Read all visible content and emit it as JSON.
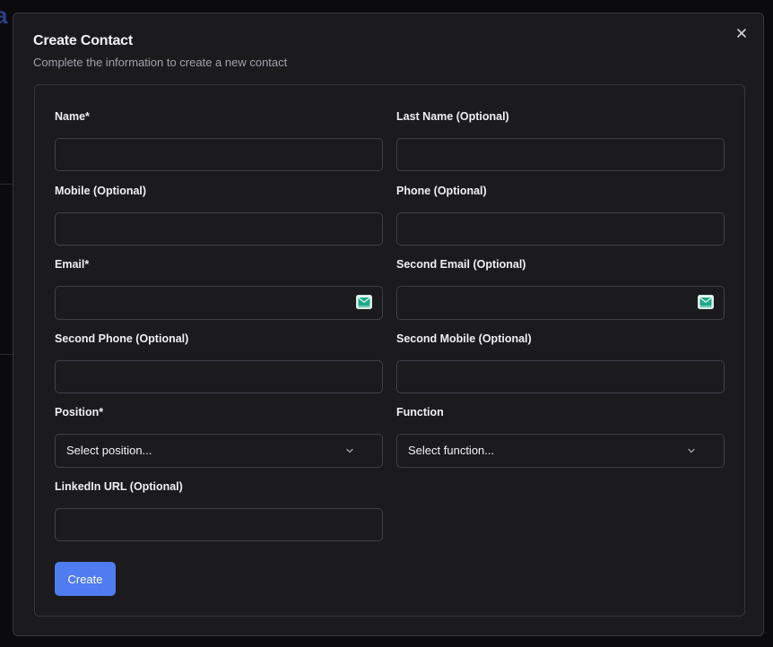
{
  "dialog": {
    "title": "Create Contact",
    "subtitle": "Complete the information to create a new contact",
    "close_label": "×"
  },
  "fields": {
    "name": {
      "label": "Name*",
      "value": ""
    },
    "last_name": {
      "label": "Last Name (Optional)",
      "value": ""
    },
    "mobile": {
      "label": "Mobile (Optional)",
      "value": ""
    },
    "phone": {
      "label": "Phone (Optional)",
      "value": ""
    },
    "email": {
      "label": "Email*",
      "value": "",
      "icon": "mail-icon"
    },
    "second_email": {
      "label": "Second Email (Optional)",
      "value": "",
      "icon": "mail-icon"
    },
    "second_phone": {
      "label": "Second Phone (Optional)",
      "value": ""
    },
    "second_mobile": {
      "label": "Second Mobile (Optional)",
      "value": ""
    },
    "position": {
      "label": "Position*",
      "selected": "Select position..."
    },
    "function": {
      "label": "Function",
      "selected": "Select function..."
    },
    "linkedin": {
      "label": "LinkedIn URL (Optional)",
      "value": ""
    }
  },
  "actions": {
    "create_label": "Create"
  },
  "colors": {
    "primary": "#4f7cf0",
    "mail_icon": "#1fa88a",
    "background": "#1b1b1e"
  }
}
